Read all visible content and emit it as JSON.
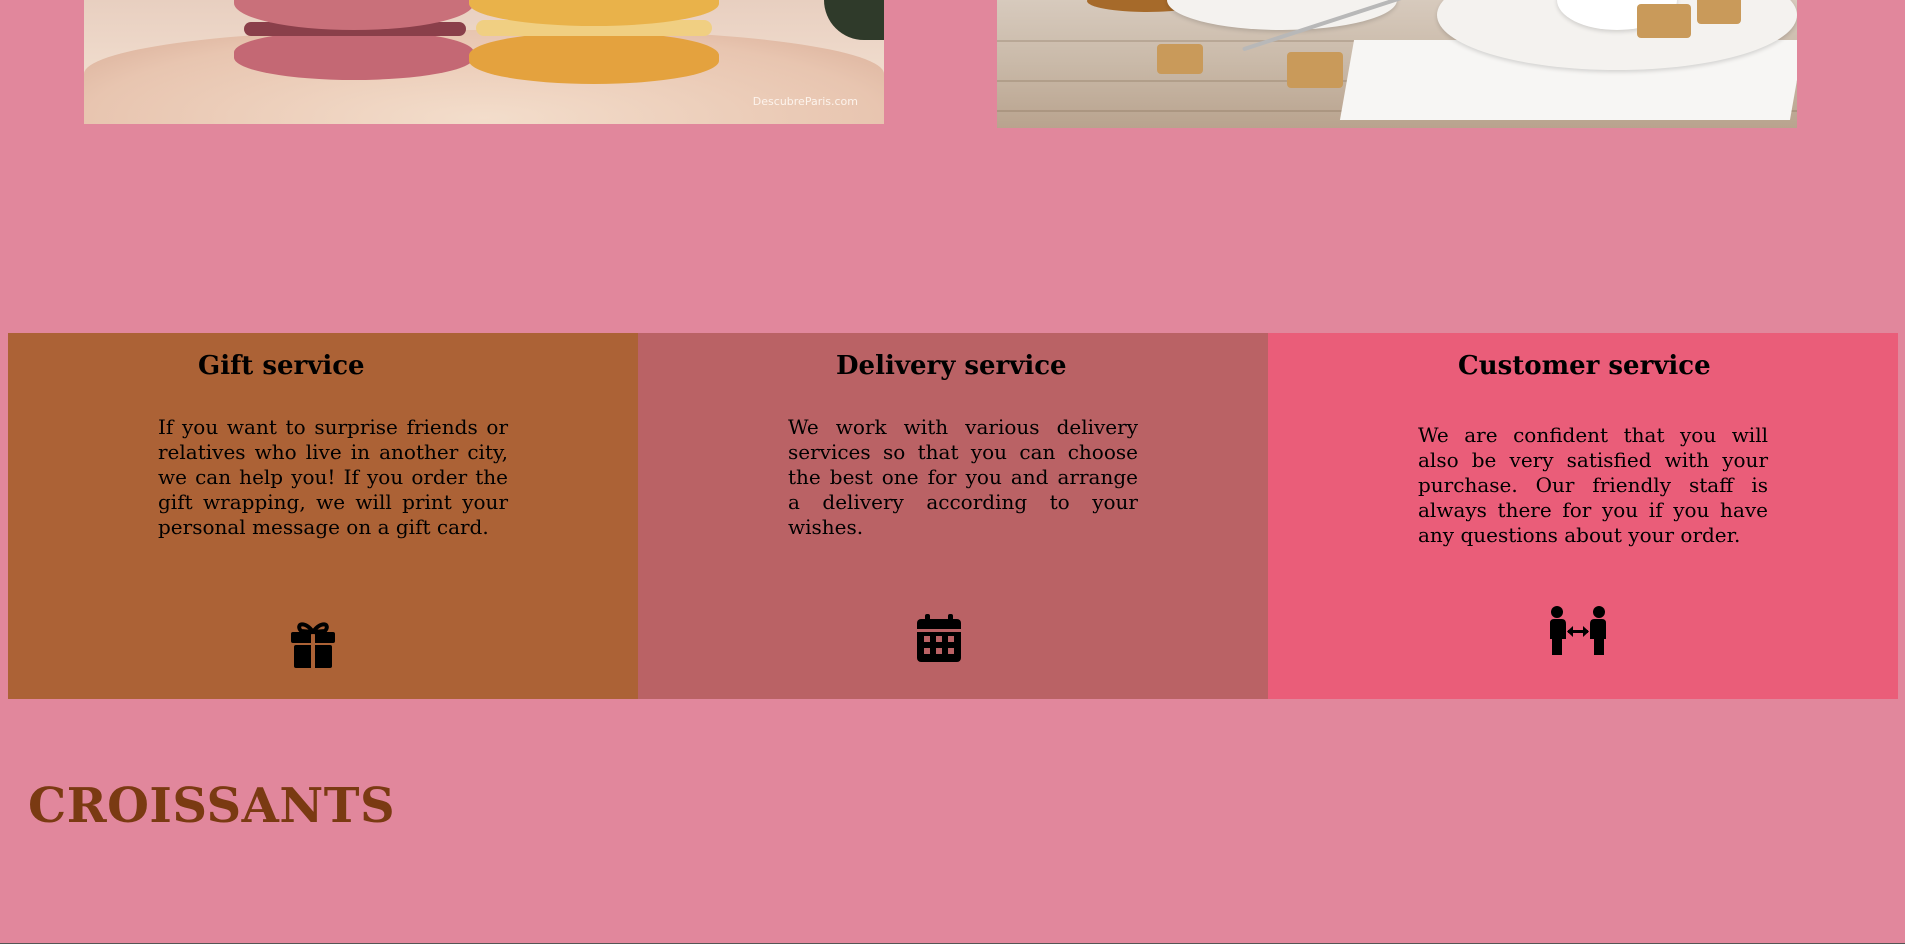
{
  "gallery": {
    "macarons_watermark": "DescubreParis.com"
  },
  "services": [
    {
      "title": "Gift service",
      "text": "If you want to surprise friends or relatives who live in another city, we can help you! If you order the gift wrapping, we will print your personal message on a gift card.",
      "icon": "gift-icon"
    },
    {
      "title": "Delivery service",
      "text": "We work with various delivery services so that you can choose the best one for you and arrange a delivery according to your wishes.",
      "icon": "calendar-icon"
    },
    {
      "title": "Customer service",
      "text": "We are confident that you will also be very satisfied with your purchase. Our friendly staff is always there for you if you have any questions about your order.",
      "icon": "people-exchange-icon"
    }
  ],
  "section_heading": "CROISSANTS",
  "colors": {
    "page_background": "#e1879c",
    "gift_card": "#ac6236",
    "delivery_card": "#ba6265",
    "customer_card": "#ea5d79",
    "section_heading": "#7a3a12"
  }
}
